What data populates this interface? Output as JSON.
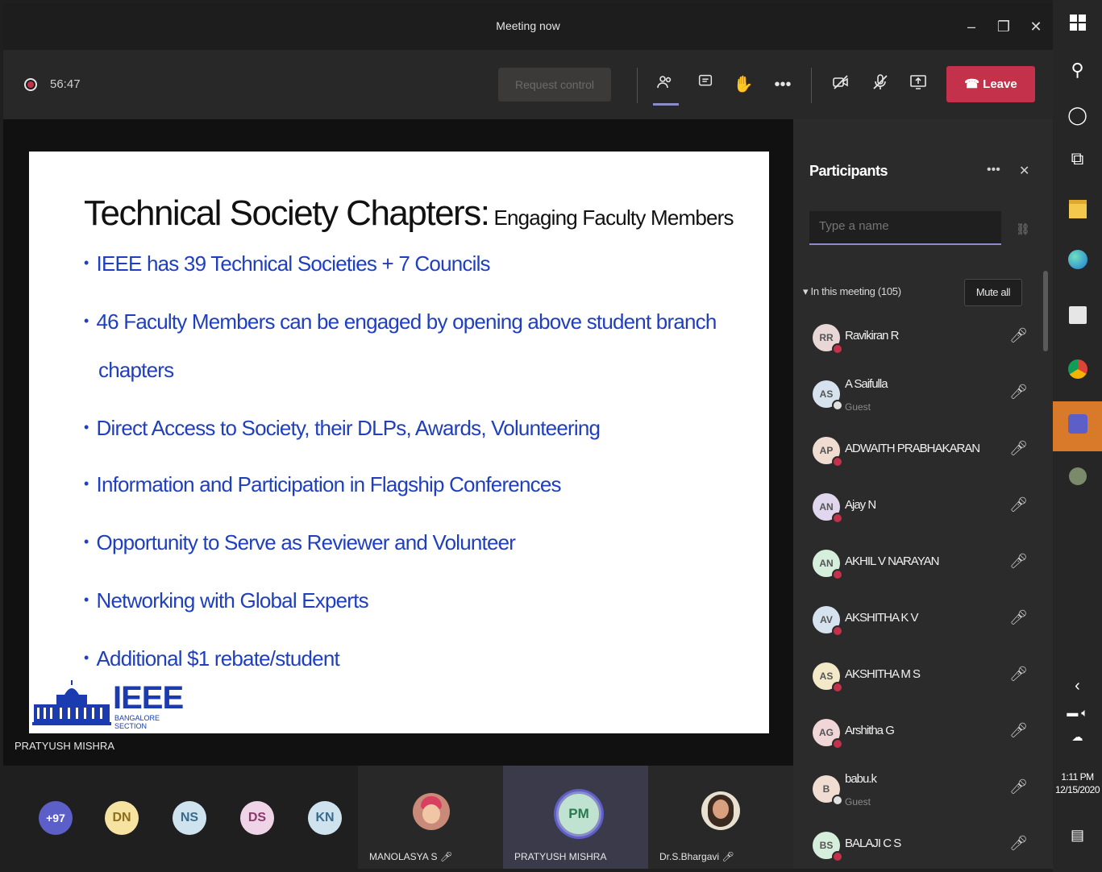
{
  "window": {
    "title": "Meeting now"
  },
  "toolbar": {
    "timer": "56:47",
    "request_control": "Request control",
    "leave": "Leave"
  },
  "slide": {
    "title_main": "Technical Society Chapters:",
    "title_sub": "Engaging Faculty Members",
    "bullets": [
      "IEEE has 39 Technical Societies + 7 Councils",
      "46 Faculty Members can be engaged by opening above student branch",
      "Direct Access to Society, their DLPs, Awards, Volunteering",
      "Information and Participation in Flagship Conferences",
      "Opportunity to Serve as Reviewer and Volunteer",
      "Networking with Global Experts",
      "Additional $1 rebate/student"
    ],
    "bullet2_cont": "chapters",
    "logo_text": "IEEE",
    "logo_sub": "BANGALORE SECTION"
  },
  "presenter": {
    "name": "PRATYUSH MISHRA"
  },
  "bottom_bar": {
    "overflow_count": "+97",
    "avatars": [
      "DN",
      "NS",
      "DS",
      "KN"
    ],
    "tiles": [
      {
        "name": "MANOLASYA S"
      },
      {
        "initials": "PM",
        "name": "PRATYUSH MISHRA"
      },
      {
        "name": "Dr.S.Bhargavi"
      }
    ]
  },
  "participants": {
    "title": "Participants",
    "search_placeholder": "Type a name",
    "section": "In this meeting (105)",
    "mute_all": "Mute all",
    "list": [
      {
        "initials": "RR",
        "name": "Ravikiran R",
        "sub": "",
        "color": "#e9d6d6"
      },
      {
        "initials": "AS",
        "name": "A Saifulla",
        "sub": "Guest",
        "color": "#d6e3ee"
      },
      {
        "initials": "AP",
        "name": "ADWAITH PRABHAKARAN",
        "sub": "",
        "color": "#f0dcd0"
      },
      {
        "initials": "AN",
        "name": "Ajay N",
        "sub": "",
        "color": "#e0d6ee"
      },
      {
        "initials": "AN",
        "name": "AKHIL V NARAYAN",
        "sub": "",
        "color": "#d6eedc"
      },
      {
        "initials": "AV",
        "name": "AKSHITHA K V",
        "sub": "",
        "color": "#d6e3ee"
      },
      {
        "initials": "AS",
        "name": "AKSHITHA M S",
        "sub": "",
        "color": "#f3e8c8"
      },
      {
        "initials": "AG",
        "name": "Arshitha G",
        "sub": "",
        "color": "#f0d6d6"
      },
      {
        "initials": "B",
        "name": "babu.k",
        "sub": "Guest",
        "color": "#f0dcd0"
      },
      {
        "initials": "BS",
        "name": "BALAJI C S",
        "sub": "",
        "color": "#d6eedc"
      }
    ]
  },
  "taskbar": {
    "time": "1:11 PM",
    "date": "12/15/2020"
  },
  "colors": {
    "accent": "#8b8cc7",
    "leave": "#c4314b",
    "slide_text": "#1f3fbf"
  }
}
